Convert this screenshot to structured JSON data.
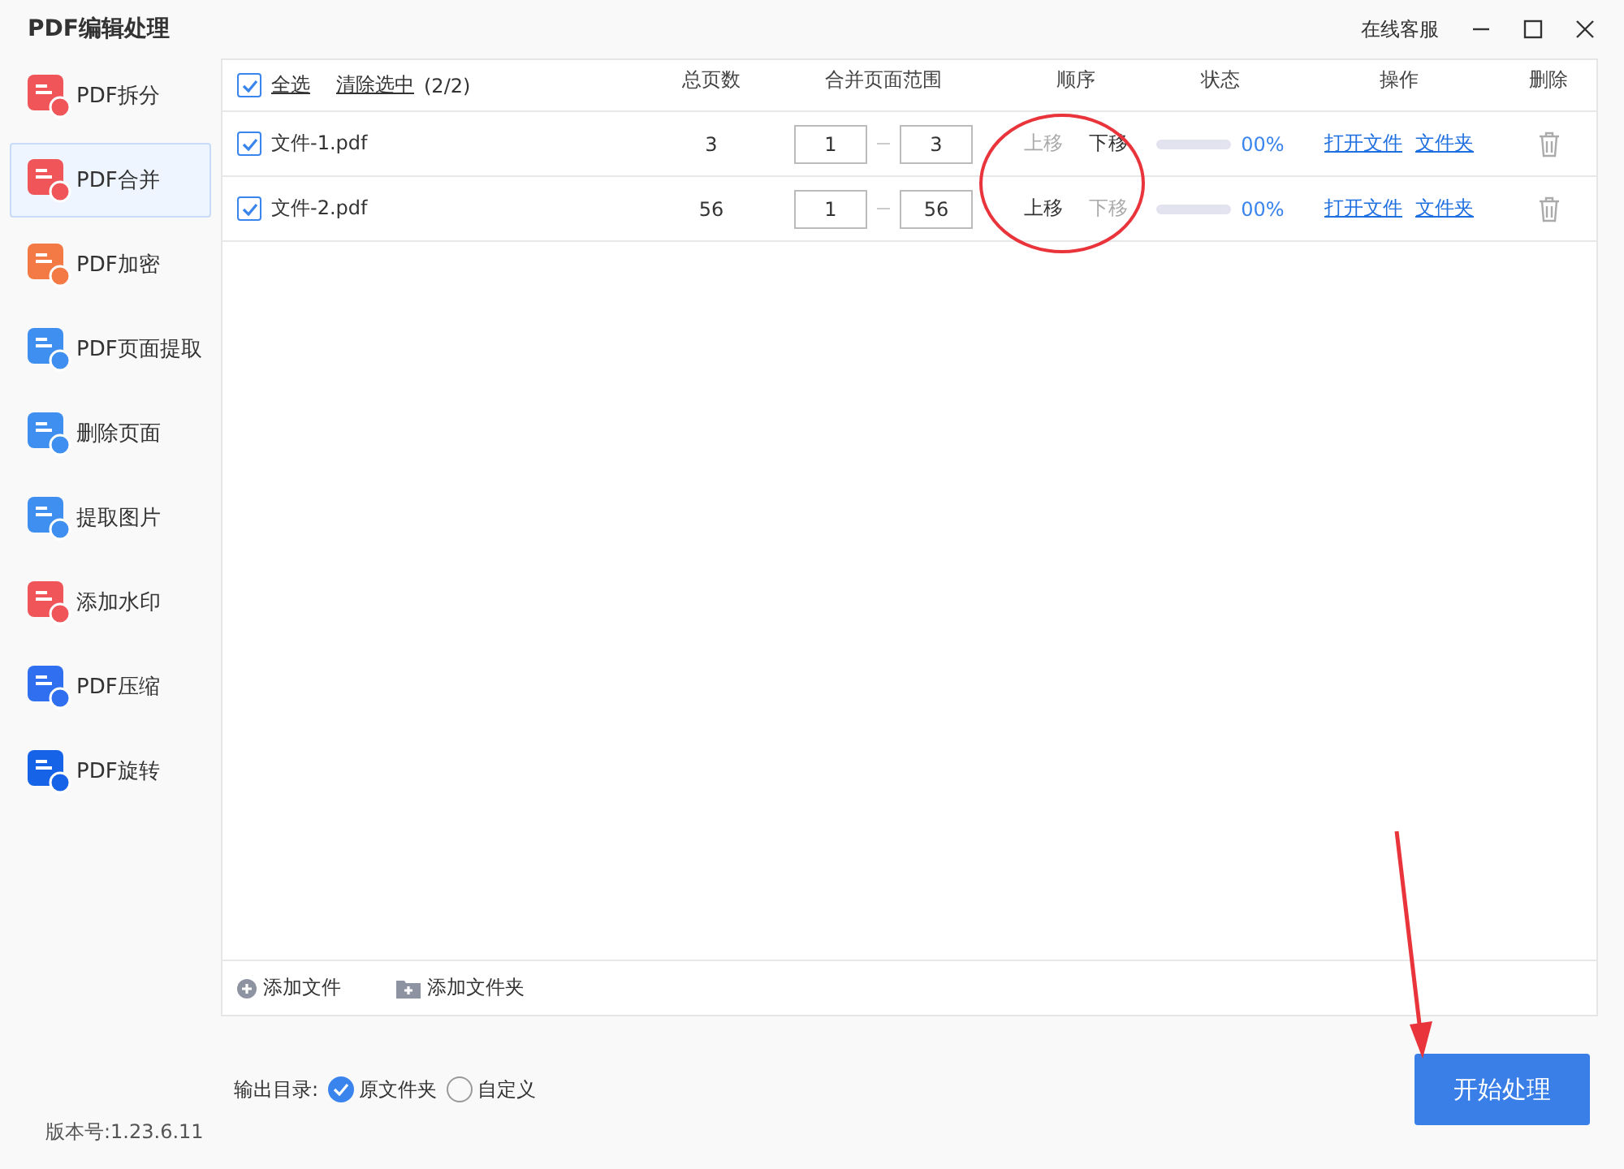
{
  "window": {
    "title": "PDF编辑处理",
    "support_link": "在线客服"
  },
  "sidebar": {
    "items": [
      {
        "label": "PDF拆分",
        "selected": false,
        "color": "#f0555a"
      },
      {
        "label": "PDF合并",
        "selected": true,
        "color": "#f0555a"
      },
      {
        "label": "PDF加密",
        "selected": false,
        "color": "#f47a45"
      },
      {
        "label": "PDF页面提取",
        "selected": false,
        "color": "#3f8ff0"
      },
      {
        "label": "删除页面",
        "selected": false,
        "color": "#3f8ff0"
      },
      {
        "label": "提取图片",
        "selected": false,
        "color": "#3f8ff0"
      },
      {
        "label": "添加水印",
        "selected": false,
        "color": "#f0555a"
      },
      {
        "label": "PDF压缩",
        "selected": false,
        "color": "#2f6ff0"
      },
      {
        "label": "PDF旋转",
        "selected": false,
        "color": "#1763e8"
      }
    ],
    "version": "版本号:1.23.6.11"
  },
  "table": {
    "select_all": {
      "label": "全选",
      "checked": true
    },
    "clear_selection": "清除选中",
    "selection_count": "(2/2)",
    "columns": [
      "总页数",
      "合并页面范围",
      "顺序",
      "状态",
      "操作",
      "删除"
    ],
    "rows": [
      {
        "checked": true,
        "name": "文件-1.pdf",
        "pages": "3",
        "range_from": "1",
        "range_to": "3",
        "move_up": {
          "label": "上移",
          "disabled": true
        },
        "move_down": {
          "label": "下移",
          "disabled": false
        },
        "level": 0,
        "status": "00%",
        "open_file": "打开文件",
        "folder": "文件夹"
      },
      {
        "checked": true,
        "name": "文件-2.pdf",
        "pages": "56",
        "range_from": "1",
        "range_to": "56",
        "move_up": {
          "label": "上移",
          "disabled": false
        },
        "move_down": {
          "label": "下移",
          "disabled": true
        },
        "level": 0,
        "status": "00%",
        "open_file": "打开文件",
        "folder": "文件夹"
      }
    ],
    "add_file": "添加文件",
    "add_folder": "添加文件夹"
  },
  "output": {
    "label": "输出目录:",
    "options": [
      {
        "label": "原文件夹",
        "selected": true
      },
      {
        "label": "自定义",
        "selected": false
      }
    ]
  },
  "start_button": "开始处理"
}
